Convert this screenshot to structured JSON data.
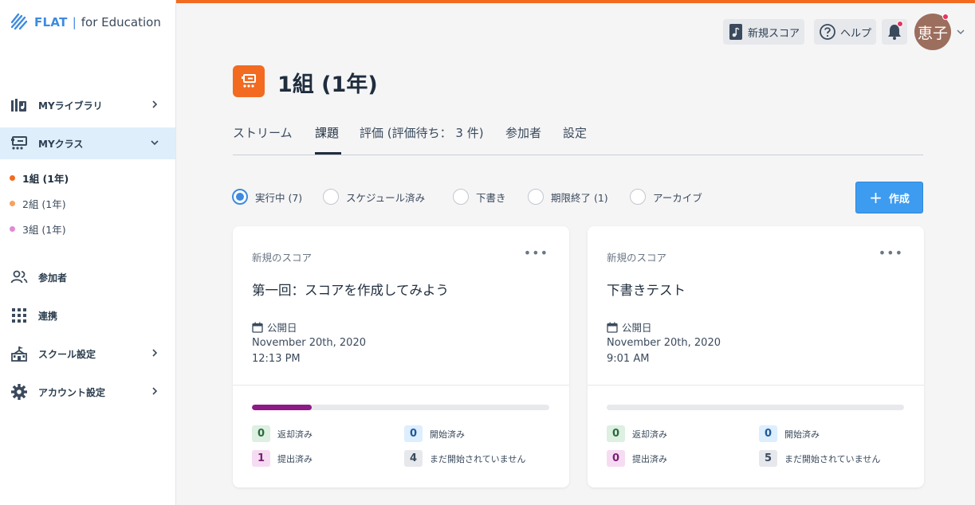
{
  "brand": {
    "name": "FLAT",
    "separator": "|",
    "suffix": "for Education"
  },
  "sidebar": {
    "items": [
      {
        "label": "MYライブラリ"
      },
      {
        "label": "MYクラス"
      },
      {
        "label": "参加者"
      },
      {
        "label": "連携"
      },
      {
        "label": "スクール設定"
      },
      {
        "label": "アカウント設定"
      }
    ],
    "classes": [
      {
        "label": "1組 (1年)",
        "color": "#f26b21"
      },
      {
        "label": "2組 (1年)",
        "color": "#f4a261"
      },
      {
        "label": "3組 (1年)",
        "color": "#e08ad6"
      }
    ]
  },
  "topbar": {
    "new_score": "新規スコア",
    "help": "ヘルプ",
    "avatar": "恵子",
    "accent_color": "#f26b21"
  },
  "header": {
    "title": "1組 (1年)"
  },
  "tabs": [
    {
      "label": "ストリーム"
    },
    {
      "label": "課題"
    },
    {
      "label": "評価 (評価待ち： 3 件)"
    },
    {
      "label": "参加者"
    },
    {
      "label": "設定"
    }
  ],
  "filters": [
    {
      "label": "実行中 (7)",
      "selected": true
    },
    {
      "label": "スケジュール済み"
    },
    {
      "label": "下書き"
    },
    {
      "label": "期限終了 (1)"
    },
    {
      "label": "アーカイブ"
    }
  ],
  "create_button": {
    "icon": "+",
    "label": "作成"
  },
  "cards": [
    {
      "type": "新規のスコア",
      "title": "第一回：スコアを作成してみよう",
      "published_label": "公開日",
      "date": "November 20th, 2020",
      "time": "12:13 PM",
      "progress": 0.2,
      "stats": {
        "returned": {
          "count": "0",
          "label": "返却済み"
        },
        "started": {
          "count": "0",
          "label": "開始済み"
        },
        "submitted": {
          "count": "1",
          "label": "提出済み"
        },
        "not_started": {
          "count": "4",
          "label": "まだ開始されていません"
        }
      }
    },
    {
      "type": "新規のスコア",
      "title": "下書きテスト",
      "published_label": "公開日",
      "date": "November 20th, 2020",
      "time": "9:01 AM",
      "progress": 0,
      "stats": {
        "returned": {
          "count": "0",
          "label": "返却済み"
        },
        "started": {
          "count": "0",
          "label": "開始済み"
        },
        "submitted": {
          "count": "0",
          "label": "提出済み"
        },
        "not_started": {
          "count": "5",
          "label": "まだ開始されていません"
        }
      }
    }
  ]
}
